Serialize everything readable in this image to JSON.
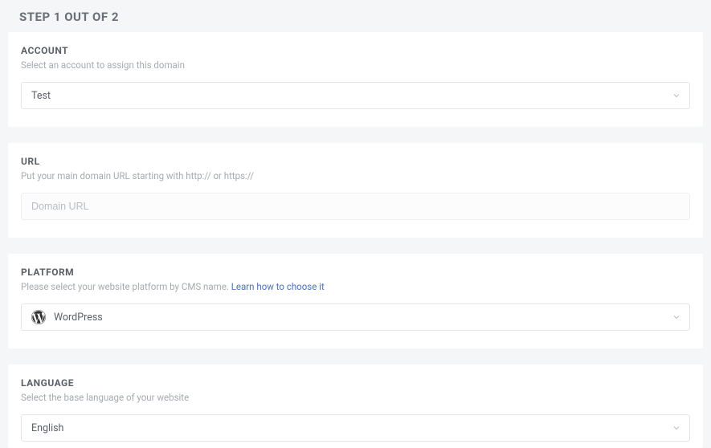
{
  "page": {
    "title": "Step 1 out of 2"
  },
  "account": {
    "label": "Account",
    "hint": "Select an account to assign this domain",
    "value": "Test"
  },
  "url": {
    "label": "URL",
    "hint": "Put your main domain URL starting with http:// or https://",
    "placeholder": "Domain URL",
    "value": ""
  },
  "platform": {
    "label": "Platform",
    "hint_prefix": "Please select your website platform by CMS name. ",
    "link_text": "Learn how to choose it",
    "value": "WordPress"
  },
  "language": {
    "label": "Language",
    "hint": "Select the base language of your website",
    "value": "English"
  }
}
